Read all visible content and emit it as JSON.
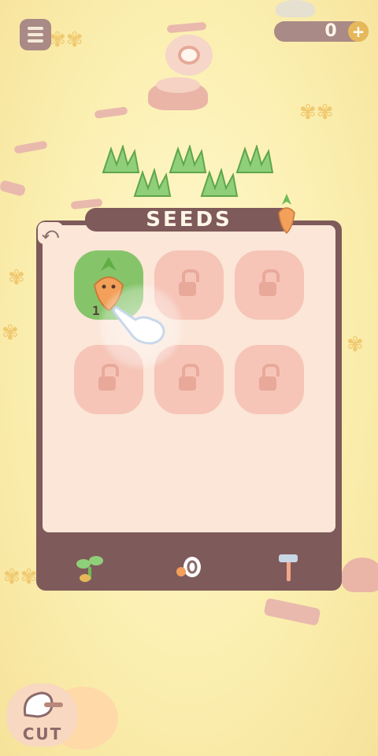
{
  "hud": {
    "coin_count": "0",
    "coin_add_label": "+"
  },
  "panel": {
    "title": "SEEDS",
    "back_label": "⤺"
  },
  "seeds": [
    {
      "name": "carrot",
      "count": "1",
      "locked": false
    },
    {
      "name": "locked",
      "locked": true
    },
    {
      "name": "locked",
      "locked": true
    },
    {
      "name": "locked",
      "locked": true
    },
    {
      "name": "locked",
      "locked": true
    },
    {
      "name": "locked",
      "locked": true
    }
  ],
  "tabs": [
    {
      "name": "seeds-tab",
      "icon": "sprout-icon",
      "active": true
    },
    {
      "name": "items-tab",
      "icon": "egg-icon",
      "active": false
    },
    {
      "name": "tools-tab",
      "icon": "hammer-icon",
      "active": false
    }
  ],
  "actions": {
    "cut_label": "CUT"
  },
  "colors": {
    "panel": "#7f5a5a",
    "panel_inner": "#fbe6d8",
    "locked_slot": "#f6c5b8",
    "unlocked_slot": "#86c46a",
    "background": "#fbefb0"
  }
}
